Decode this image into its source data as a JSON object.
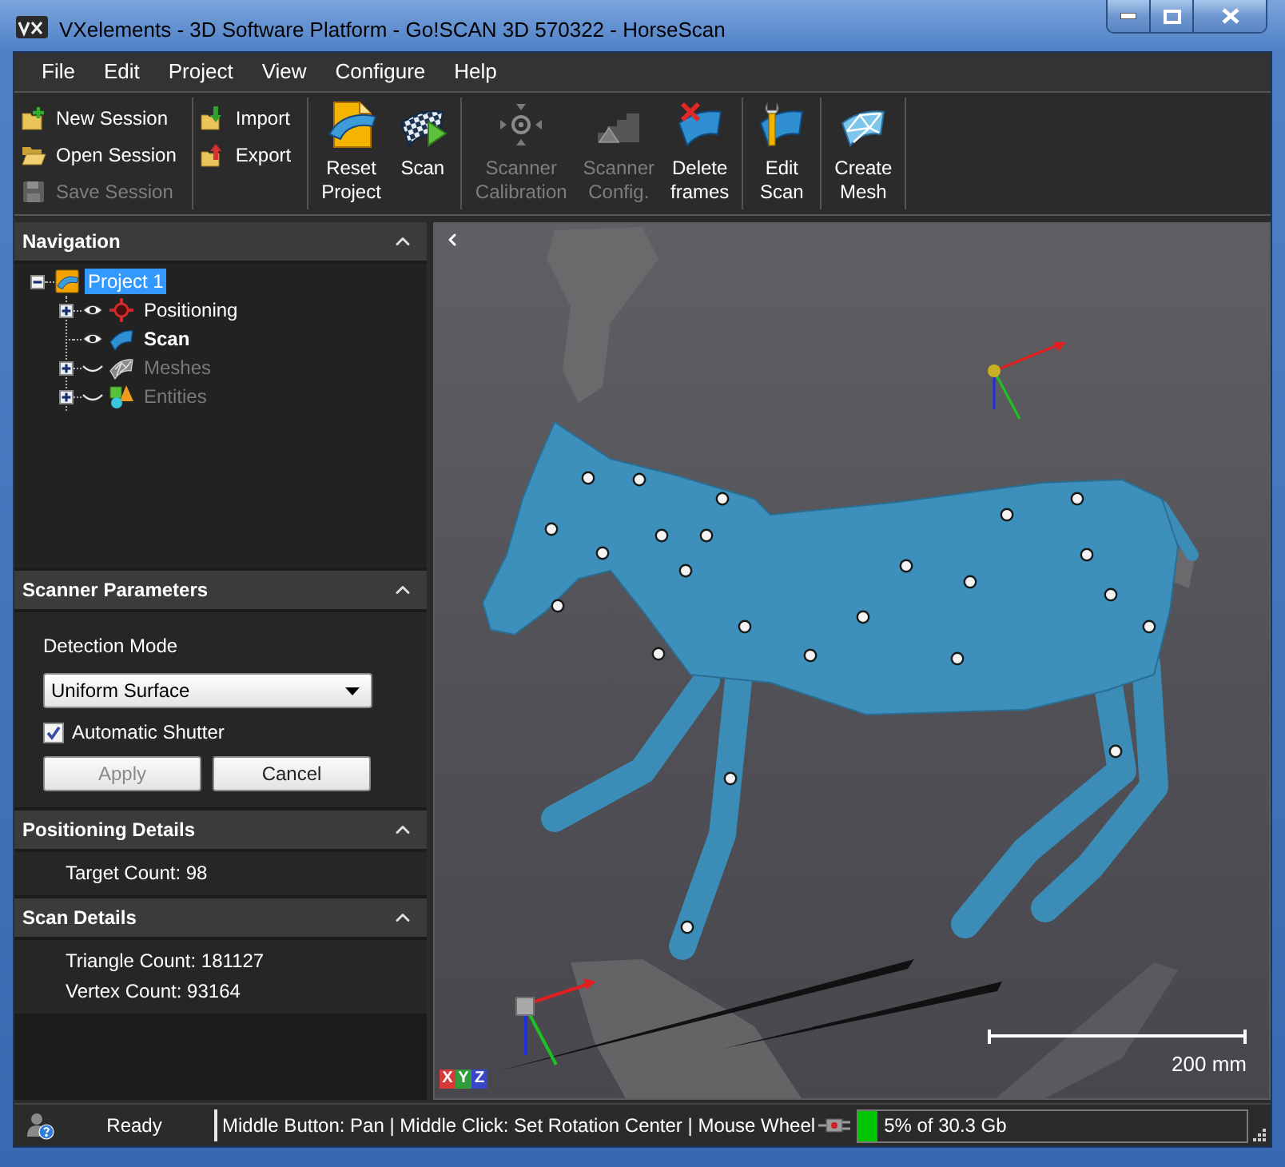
{
  "window": {
    "title": "VXelements - 3D Software Platform - Go!SCAN 3D 570322 - HorseScan"
  },
  "menu": [
    "File",
    "Edit",
    "Project",
    "View",
    "Configure",
    "Help"
  ],
  "toolbar": [
    {
      "kind": "small",
      "items": [
        {
          "label": "New Session",
          "disabled": false
        },
        {
          "label": "Open Session",
          "disabled": false
        },
        {
          "label": "Save Session",
          "disabled": true
        }
      ]
    },
    {
      "kind": "small",
      "items": [
        {
          "label": "Import",
          "disabled": false
        },
        {
          "label": "Export",
          "disabled": false
        }
      ]
    },
    {
      "kind": "large",
      "items": [
        {
          "label": "Reset Project",
          "disabled": false
        },
        {
          "label": "Scan",
          "disabled": false
        }
      ]
    },
    {
      "kind": "large",
      "items": [
        {
          "label": "Scanner Calibration",
          "disabled": true
        },
        {
          "label": "Scanner Config.",
          "disabled": true
        },
        {
          "label": "Delete frames",
          "disabled": false
        }
      ]
    },
    {
      "kind": "large",
      "items": [
        {
          "label": "Edit Scan",
          "disabled": false
        }
      ]
    },
    {
      "kind": "large",
      "items": [
        {
          "label": "Create Mesh",
          "disabled": false
        }
      ]
    }
  ],
  "navigation": {
    "title": "Navigation",
    "expanded": true,
    "tree": [
      {
        "label": "Project 1",
        "selected": true,
        "expandable": true,
        "expanded": true,
        "children": [
          {
            "label": "Positioning",
            "selected": false,
            "active": false,
            "disabled": false,
            "visible": true,
            "expandable": true,
            "expanded": false
          },
          {
            "label": "Scan",
            "selected": false,
            "active": true,
            "disabled": false,
            "visible": true,
            "expandable": false,
            "expanded": false
          },
          {
            "label": "Meshes",
            "selected": false,
            "active": false,
            "disabled": true,
            "visible": false,
            "expandable": true,
            "expanded": false
          },
          {
            "label": "Entities",
            "selected": false,
            "active": false,
            "disabled": true,
            "visible": false,
            "expandable": true,
            "expanded": false
          }
        ]
      }
    ]
  },
  "scanner_parameters": {
    "title": "Scanner Parameters",
    "expanded": true,
    "detection_mode_label": "Detection Mode",
    "detection_mode": {
      "value": "Uniform Surface"
    },
    "automatic_shutter": {
      "label": "Automatic Shutter",
      "checked": true
    },
    "buttons": [
      {
        "label": "Apply",
        "disabled": true
      },
      {
        "label": "Cancel",
        "disabled": false
      }
    ]
  },
  "positioning_details": {
    "title": "Positioning Details",
    "expanded": true,
    "lines": [
      "Target Count: 98"
    ]
  },
  "scan_details": {
    "title": "Scan Details",
    "expanded": true,
    "lines": [
      "Triangle Count: 181127",
      "Vertex Count: 93164"
    ]
  },
  "viewport": {
    "axis_labels": [
      {
        "label": "X",
        "color": "#d83a3a"
      },
      {
        "label": "Y",
        "color": "#2f9e3a"
      },
      {
        "label": "Z",
        "color": "#3a46c8"
      }
    ],
    "scale": "200 mm"
  },
  "status_bar": {
    "state": "Ready",
    "hint": "Middle Button: Pan | Middle Click: Set Rotation Center | Mouse Wheel",
    "memory": {
      "level": 0.05,
      "reading": "5% of 30.3 Gb"
    }
  }
}
